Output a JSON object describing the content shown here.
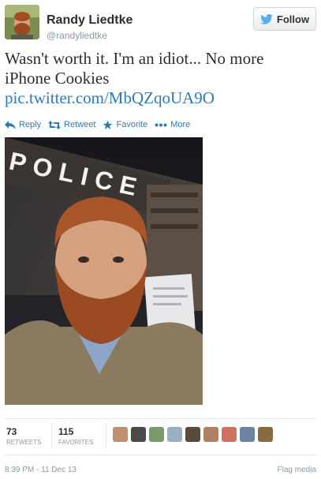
{
  "user": {
    "name": "Randy Liedtke",
    "handle": "@randyliedtke",
    "follow_label": "Follow"
  },
  "tweet": {
    "text": "Wasn't worth it. I'm an idiot... No more iPhone Cookies",
    "link": "pic.twitter.com/MbQZqoUA9O"
  },
  "actions": {
    "reply": "Reply",
    "retweet": "Retweet",
    "favorite": "Favorite",
    "more": "More"
  },
  "photo": {
    "sign_text": "POLICE"
  },
  "stats": {
    "retweets_count": "73",
    "retweets_label": "RETWEETS",
    "favorites_count": "115",
    "favorites_label": "FAVORITES"
  },
  "footer": {
    "timestamp": "8:39 PM - 11 Dec 13",
    "flag_label": "Flag media"
  },
  "colors": {
    "link": "#2b7bb9",
    "muted": "#8899a6"
  }
}
